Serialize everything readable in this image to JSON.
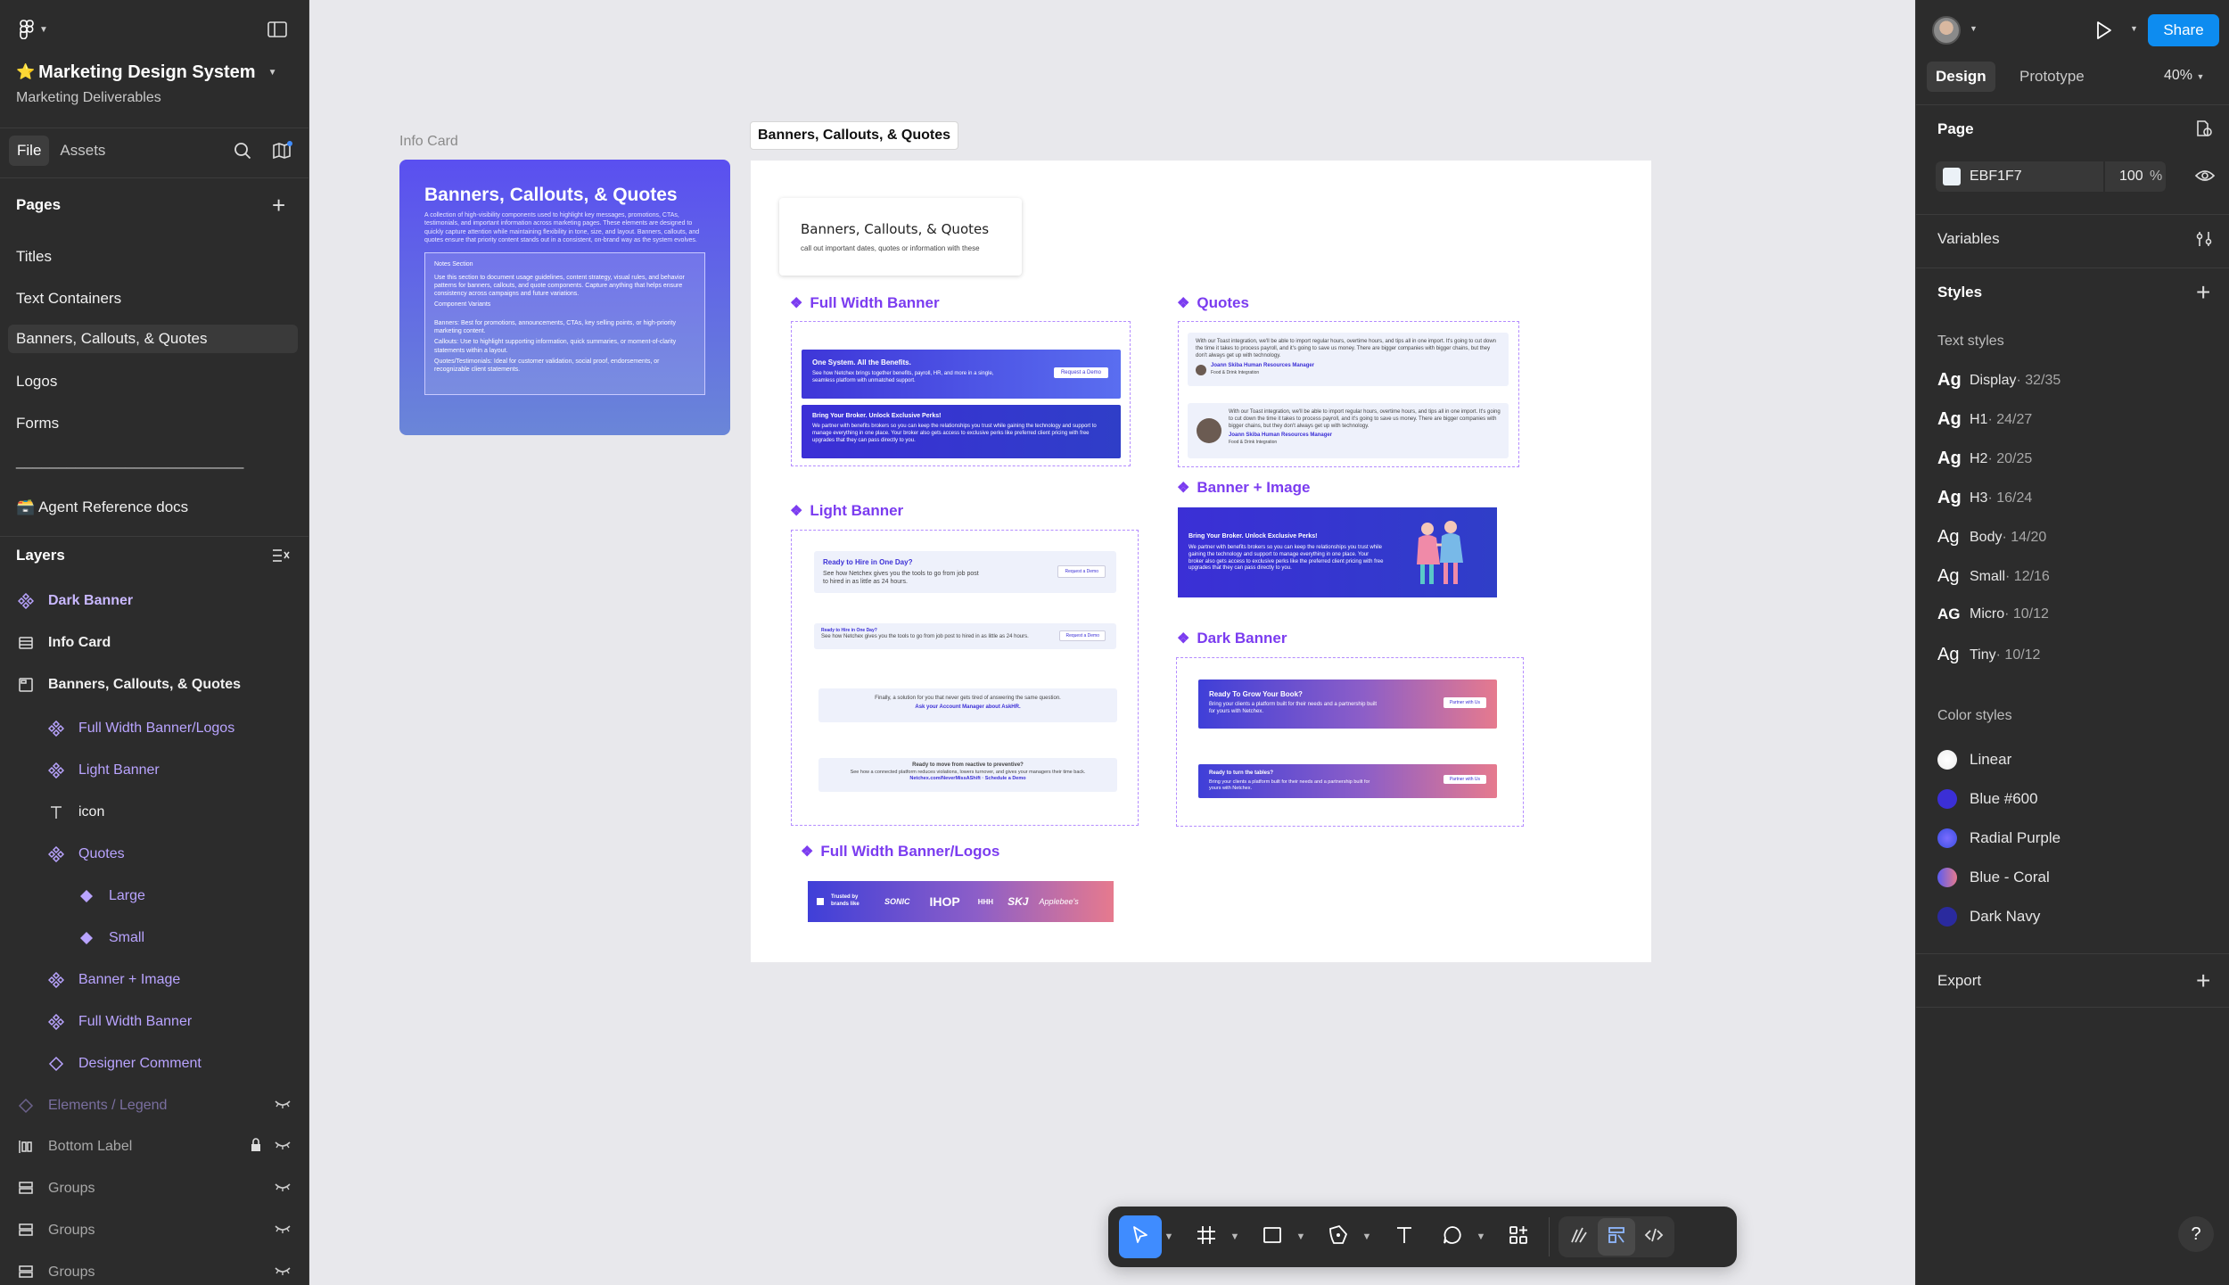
{
  "file": {
    "name": "Marketing Design System",
    "star": "⭐",
    "project": "Marketing Deliverables"
  },
  "left_tabs": {
    "file": "File",
    "assets": "Assets"
  },
  "pages": {
    "title": "Pages",
    "items": [
      "Titles",
      "Text Containers",
      "Banners, Callouts, & Quotes",
      "Logos",
      "Forms"
    ],
    "divider_text": "___________________________",
    "extra": "🗃️ Agent Reference docs"
  },
  "layers": {
    "title": "Layers",
    "items": [
      {
        "label": "Dark Banner",
        "icon": "component-icon"
      },
      {
        "label": "Info Card",
        "icon": "frame-icon"
      },
      {
        "label": "Banners, Callouts, & Quotes",
        "icon": "section-icon"
      },
      {
        "label": "Full Width Banner/Logos",
        "icon": "component-icon"
      },
      {
        "label": "Light Banner",
        "icon": "component-icon"
      },
      {
        "label": "icon",
        "icon": "text-icon"
      },
      {
        "label": "Quotes",
        "icon": "component-icon"
      },
      {
        "label": "Large",
        "icon": "variant-icon"
      },
      {
        "label": "Small",
        "icon": "variant-icon"
      },
      {
        "label": "Banner + Image",
        "icon": "component-icon"
      },
      {
        "label": "Full Width Banner",
        "icon": "component-icon"
      },
      {
        "label": "Designer Comment",
        "icon": "instance-icon"
      },
      {
        "label": "Elements / Legend",
        "icon": "instance-icon"
      },
      {
        "label": "Bottom Label",
        "icon": "autolayout-icon"
      },
      {
        "label": "Groups",
        "icon": "group-icon"
      },
      {
        "label": "Groups",
        "icon": "group-icon"
      },
      {
        "label": "Groups",
        "icon": "group-icon"
      }
    ]
  },
  "right": {
    "share": "Share",
    "tabs": {
      "design": "Design",
      "prototype": "Prototype"
    },
    "zoom": "40%",
    "page": {
      "title": "Page",
      "color": "EBF1F7",
      "opacity": "100",
      "pct": "%"
    },
    "variables": "Variables",
    "styles": "Styles",
    "text_styles_title": "Text styles",
    "text_styles": [
      {
        "ag": "Ag",
        "name": "Display",
        "size": " · 32/35"
      },
      {
        "ag": "Ag",
        "name": "H1",
        "size": " · 24/27"
      },
      {
        "ag": "Ag",
        "name": "H2",
        "size": " · 20/25"
      },
      {
        "ag": "Ag",
        "name": "H3",
        "size": " · 16/24"
      },
      {
        "ag": "Ag",
        "name": "Body",
        "size": " · 14/20"
      },
      {
        "ag": "Ag",
        "name": "Small",
        "size": " · 12/16"
      },
      {
        "ag": "AG",
        "name": "Micro",
        "size": " · 10/12"
      },
      {
        "ag": "Ag",
        "name": "Tiny",
        "size": " · 10/12"
      }
    ],
    "color_styles_title": "Color styles",
    "color_styles": [
      {
        "name": "Linear",
        "color": "#ffffff"
      },
      {
        "name": "Blue #600",
        "color": "#3b2fd6"
      },
      {
        "name": "Radial Purple",
        "color": "#5b5cf0"
      },
      {
        "name": "Blue - Coral",
        "color": "#e07a8a"
      },
      {
        "name": "Dark Navy",
        "color": "#2a2a9e"
      }
    ],
    "export": "Export",
    "help": "?"
  },
  "canvas": {
    "info_card_label": "Info Card",
    "info_card_title": "Banners, Callouts, & Quotes",
    "info_card_body": "A collection of high-visibility components used to highlight key messages, promotions, CTAs, testimonials, and important information across marketing pages. These elements are designed to quickly capture attention while maintaining flexibility in tone, size, and layout. Banners, callouts, and quotes ensure that priority content stands out in a consistent, on-brand way as the system evolves.",
    "notes_title": "Notes Section",
    "notes_body": "Use this section to document usage guidelines, content strategy, visual rules, and behavior patterns for banners, callouts, and quote components. Capture anything that helps ensure consistency across campaigns and future variations.",
    "notes_variants": "Component Variants",
    "notes_list": [
      "Banners: Best for promotions, announcements, CTAs, key selling points, or high-priority marketing content.",
      "Callouts: Use to highlight supporting information, quick summaries, or moment-of-clarity statements within a layout.",
      "Quotes/Testimonials: Ideal for customer validation, social proof, endorsements, or recognizable client statements."
    ],
    "section_label": "Banners, Callouts, & Quotes",
    "header_card_title": "Banners, Callouts, & Quotes",
    "header_card_sub": "call out important dates, quotes or information with these",
    "full_width_banner": "Full Width Banner",
    "quotes": "Quotes",
    "light_banner": "Light Banner",
    "banner_image": "Banner + Image",
    "dark_banner": "Dark Banner",
    "full_width_logos": "Full Width Banner/Logos",
    "fwb1_title": "One System. All the Benefits.",
    "fwb1_body": "See how Netchex brings together benefits, payroll, HR, and more in a single, seamless platform with unmatched support.",
    "fwb1_btn": "Request a Demo",
    "fwb2_title": "Bring Your Broker. Unlock Exclusive Perks!",
    "fwb2_body": "We partner with benefits brokers so you can keep the relationships you trust while gaining the technology and support to manage everything in one place. Your broker also gets access to exclusive perks like preferred client pricing with free upgrades that they can pass directly to you.",
    "q1_body": "With our Toast integration, we'll be able to import regular hours, overtime hours, and tips all in one import. It's going to cut down the time it takes to process payroll, and it's going to save us money. There are bigger companies with bigger chains, but they don't always get up with technology.",
    "q1_name": "Joann Skiba Human Resources Manager",
    "q1_co": "Food & Drink Integration",
    "q2_body": "With our Toast integration, we'll be able to import regular hours, overtime hours, and tips all in one import. It's going to cut down the time it takes to process payroll, and it's going to save us money. There are bigger companies with bigger chains, but they don't always get up with technology.",
    "q2_name": "Joann Skiba Human Resources Manager",
    "q2_co": "Food & Drink Integration",
    "bi_title": "Bring Your Broker. Unlock Exclusive Perks!",
    "bi_body": "We partner with benefits brokers so you can keep the relationships you trust while gaining the technology and support to manage everything in one place. Your broker also gets access to exclusive perks like the preferred client pricing with free upgrades that they can pass directly to you.",
    "lb1_title": "Ready to Hire in One Day?",
    "lb1_body": "See how Netchex gives you the tools to go from job post to hired in as little as 24 hours.",
    "lb1_btn": "Request a Demo",
    "lb2_title": "Ready to Hire in One Day?",
    "lb2_body": "See how Netchex gives you the tools to go from job post to hired in as little as 24 hours.",
    "lb2_btn": "Request a Demo",
    "lb3_body": "Finally, a solution for you that never gets tired of answering the same question.",
    "lb3_link": "Ask your Account Manager about AskHR.",
    "lb4_title": "Ready to move from reactive to preventive?",
    "lb4_body": "See how a connected platform reduces violations, lowers turnover, and gives your managers their time back.",
    "lb4_link": "Netchex.com/NeverMissAShift · Schedule a Demo",
    "db1_title": "Ready To Grow Your Book?",
    "db1_body": "Bring your clients a platform built for their needs and a partnership built for yours with Netchex.",
    "db1_btn": "Partner with Us",
    "db2_title": "Ready to turn the tables?",
    "db2_body": "Bring your clients a platform built for their needs and a partnership built for yours with Netchex.",
    "db2_btn": "Partner with Us",
    "logos_trusted": "Trusted by brands like",
    "logos": [
      "SONIC",
      "IHOP",
      "HHH",
      "SKJ",
      "Applebee's"
    ]
  }
}
